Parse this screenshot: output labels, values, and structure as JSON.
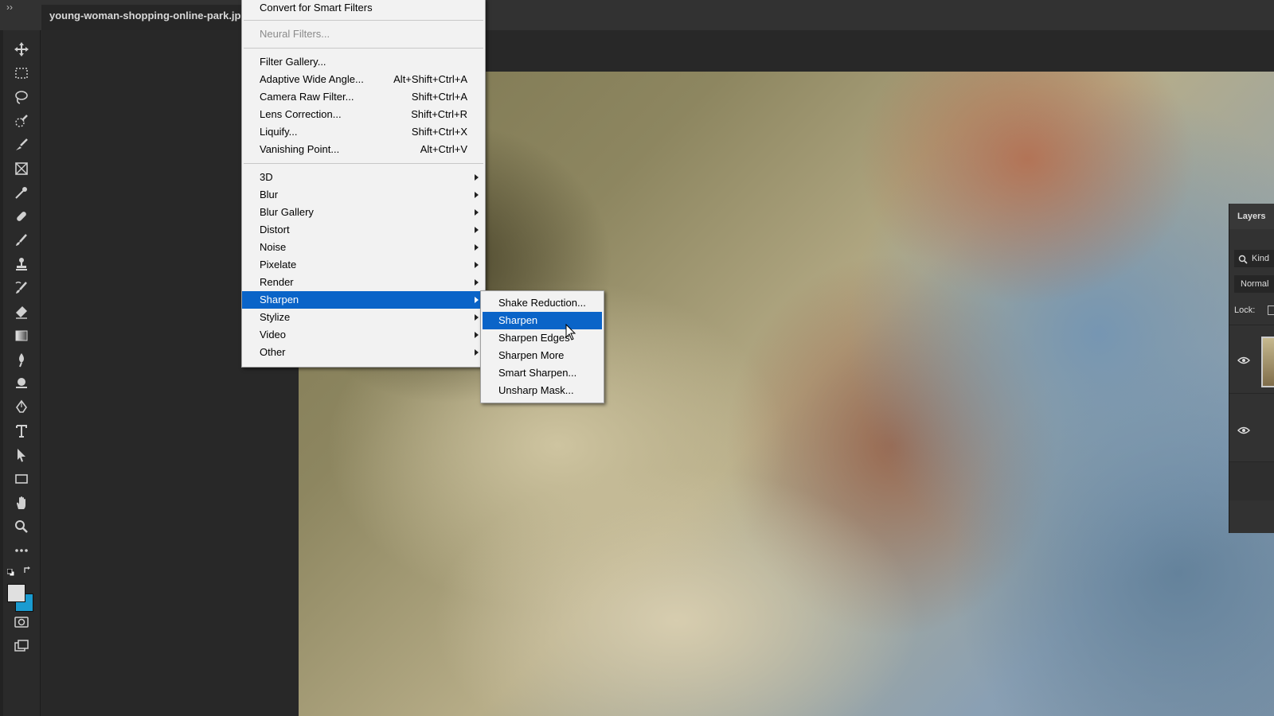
{
  "document": {
    "tab_title": "young-woman-shopping-online-park.jp"
  },
  "toolbar": {
    "collapse": "››",
    "tools": [
      "move-tool-icon",
      "marquee-tool-icon",
      "lasso-tool-icon",
      "quick-selection-tool-icon",
      "brush-selection-icon",
      "frame-tool-icon",
      "eyedropper-tool-icon",
      "healing-brush-icon",
      "brush-tool-icon",
      "clone-stamp-icon",
      "history-brush-icon",
      "eraser-tool-icon",
      "gradient-tool-icon",
      "blur-tool-icon",
      "dodge-tool-icon",
      "pen-tool-icon",
      "type-tool-icon",
      "path-selection-icon",
      "rectangle-tool-icon",
      "hand-tool-icon",
      "zoom-tool-icon",
      "more-tools-icon"
    ],
    "colors": {
      "foreground": "#e0e0e0",
      "background": "#1a9bd0"
    }
  },
  "filter_menu": {
    "items": [
      {
        "label": "Convert for Smart Filters",
        "shortcut": "",
        "type": "item"
      },
      {
        "type": "separator"
      },
      {
        "label": "Neural Filters...",
        "shortcut": "",
        "type": "disabled"
      },
      {
        "type": "separator"
      },
      {
        "label": "Filter Gallery...",
        "shortcut": "",
        "type": "item"
      },
      {
        "label": "Adaptive Wide Angle...",
        "shortcut": "Alt+Shift+Ctrl+A",
        "type": "item"
      },
      {
        "label": "Camera Raw Filter...",
        "shortcut": "Shift+Ctrl+A",
        "type": "item"
      },
      {
        "label": "Lens Correction...",
        "shortcut": "Shift+Ctrl+R",
        "type": "item"
      },
      {
        "label": "Liquify...",
        "shortcut": "Shift+Ctrl+X",
        "type": "item"
      },
      {
        "label": "Vanishing Point...",
        "shortcut": "Alt+Ctrl+V",
        "type": "item"
      },
      {
        "type": "separator"
      },
      {
        "label": "3D",
        "type": "submenu"
      },
      {
        "label": "Blur",
        "type": "submenu"
      },
      {
        "label": "Blur Gallery",
        "type": "submenu"
      },
      {
        "label": "Distort",
        "type": "submenu"
      },
      {
        "label": "Noise",
        "type": "submenu"
      },
      {
        "label": "Pixelate",
        "type": "submenu"
      },
      {
        "label": "Render",
        "type": "submenu"
      },
      {
        "label": "Sharpen",
        "type": "submenu",
        "highlighted": true
      },
      {
        "label": "Stylize",
        "type": "submenu"
      },
      {
        "label": "Video",
        "type": "submenu"
      },
      {
        "label": "Other",
        "type": "submenu"
      }
    ]
  },
  "sharpen_submenu": {
    "items": [
      {
        "label": "Shake Reduction..."
      },
      {
        "label": "Sharpen",
        "highlighted": true
      },
      {
        "label": "Sharpen Edges"
      },
      {
        "label": "Sharpen More"
      },
      {
        "label": "Smart Sharpen..."
      },
      {
        "label": "Unsharp Mask..."
      }
    ]
  },
  "layers_panel": {
    "tab_label": "Layers",
    "kind_label": "Kind",
    "blend_mode": "Normal",
    "lock_label": "Lock:"
  },
  "colors": {
    "menu_highlight": "#0a64c8",
    "menu_bg": "#f2f2f2"
  }
}
